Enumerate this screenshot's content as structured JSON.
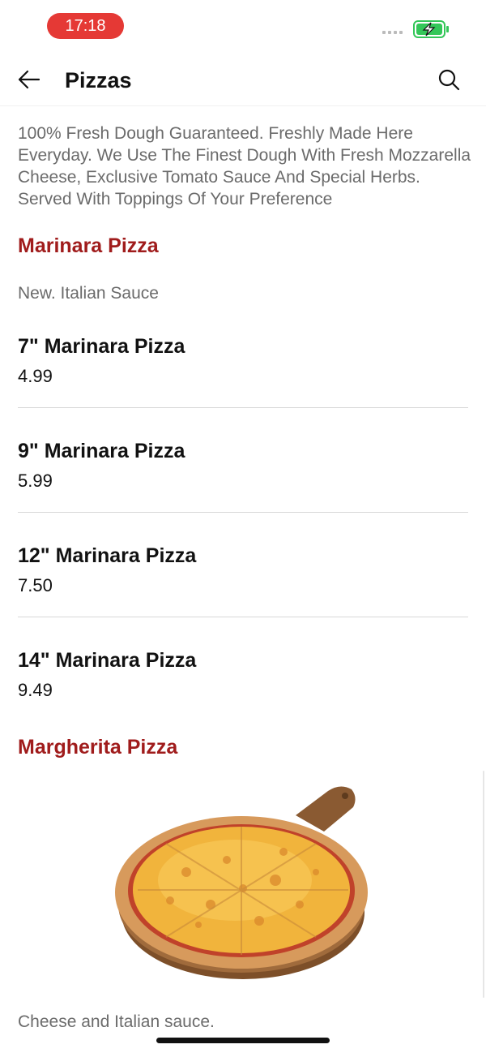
{
  "status_bar": {
    "time": "17:18",
    "battery_color": "#34c759",
    "time_pill_color": "#e53935"
  },
  "header": {
    "title": "Pizzas",
    "back_icon": "arrow-left-icon",
    "search_icon": "search-icon"
  },
  "category_description": "100% Fresh Dough Guaranteed. Freshly Made Here Everyday. We Use The Finest Dough With Fresh Mozzarella Cheese, Exclusive Tomato Sauce And Special Herbs. Served With Toppings Of Your Preference",
  "sections": [
    {
      "title": "Marinara Pizza",
      "description": "New. Italian Sauce",
      "items": [
        {
          "name": "7\" Marinara Pizza",
          "price": "4.99"
        },
        {
          "name": "9\" Marinara Pizza",
          "price": "5.99"
        },
        {
          "name": "12\" Marinara Pizza",
          "price": "7.50"
        },
        {
          "name": "14\" Marinara Pizza",
          "price": "9.49"
        }
      ]
    },
    {
      "title": "Margherita Pizza",
      "description": "Cheese and Italian sauce.",
      "image": "margherita-pizza-photo"
    }
  ],
  "colors": {
    "section_title": "#a01c1c",
    "muted_text": "#6b6b6b"
  }
}
